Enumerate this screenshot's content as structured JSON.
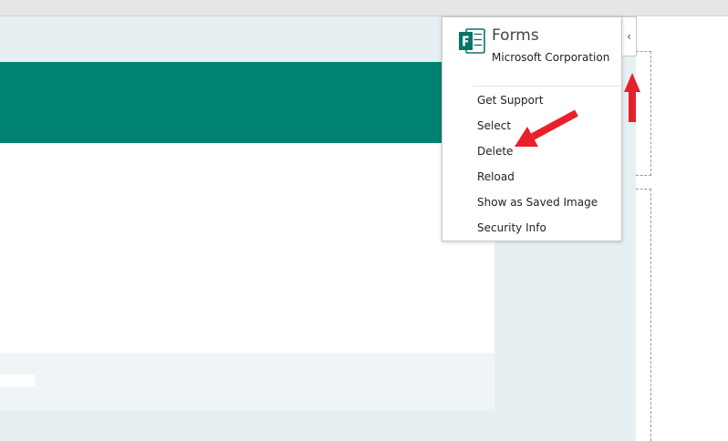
{
  "addin_menu": {
    "app_name": "Forms",
    "publisher": "Microsoft Corporation",
    "logo_icon": "microsoft-forms-logo",
    "items": [
      {
        "label": "Get Support"
      },
      {
        "label": "Select"
      },
      {
        "label": "Delete"
      },
      {
        "label": "Reload"
      },
      {
        "label": "Show as Saved Image"
      },
      {
        "label": "Security Info"
      }
    ]
  },
  "collapse_button": {
    "icon": "chevron-left-icon",
    "glyph": "‹"
  },
  "colors": {
    "banner": "#008272",
    "annotation_arrow": "#e8202a",
    "canvas": "#e6eff2"
  }
}
